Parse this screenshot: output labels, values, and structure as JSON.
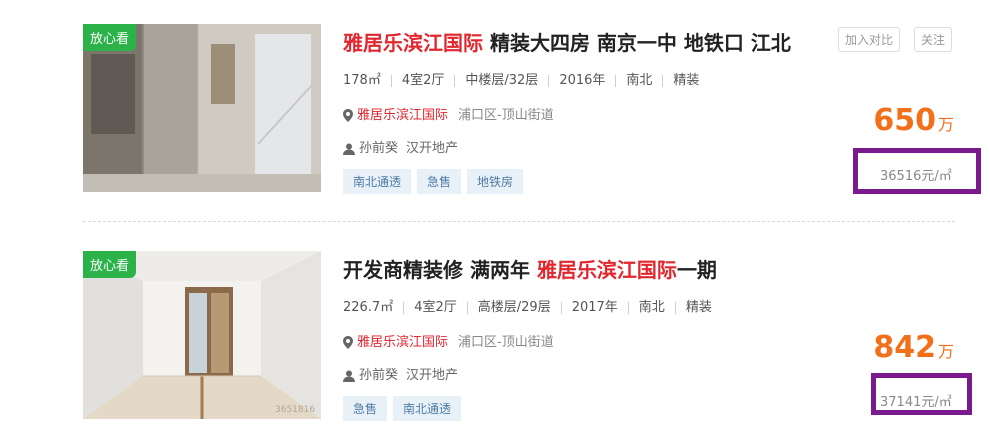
{
  "listings": [
    {
      "badge": "放心看",
      "title_hl": "雅居乐滨江国际",
      "title_rest": " 精装大四房 南京一中 地铁口 江北",
      "area": "178㎡",
      "layout": "4室2厅",
      "floor": "中楼层/32层",
      "year": "2016年",
      "orientation": "南北",
      "decoration": "精装",
      "community": "雅居乐滨江国际",
      "district": "浦口区-顶山街道",
      "agent": "孙前癸",
      "company": "汉开地产",
      "tags": [
        "南北通透",
        "急售",
        "地铁房"
      ],
      "compare_label": "加入对比",
      "follow_label": "关注",
      "price": "650",
      "price_unit": "万",
      "unit_price": "36516元/㎡"
    },
    {
      "badge": "放心看",
      "title_pre": "开发商精装修 满两年 ",
      "title_hl": "雅居乐滨江国际",
      "title_post": "一期",
      "area": "226.7㎡",
      "layout": "4室2厅",
      "floor": "高楼层/29层",
      "year": "2017年",
      "orientation": "南北",
      "decoration": "精装",
      "community": "雅居乐滨江国际",
      "district": "浦口区-顶山街道",
      "agent": "孙前癸",
      "company": "汉开地产",
      "tags": [
        "急售",
        "南北通透"
      ],
      "price": "842",
      "price_unit": "万",
      "unit_price": "37141元/㎡",
      "watermark": "3651816"
    }
  ]
}
